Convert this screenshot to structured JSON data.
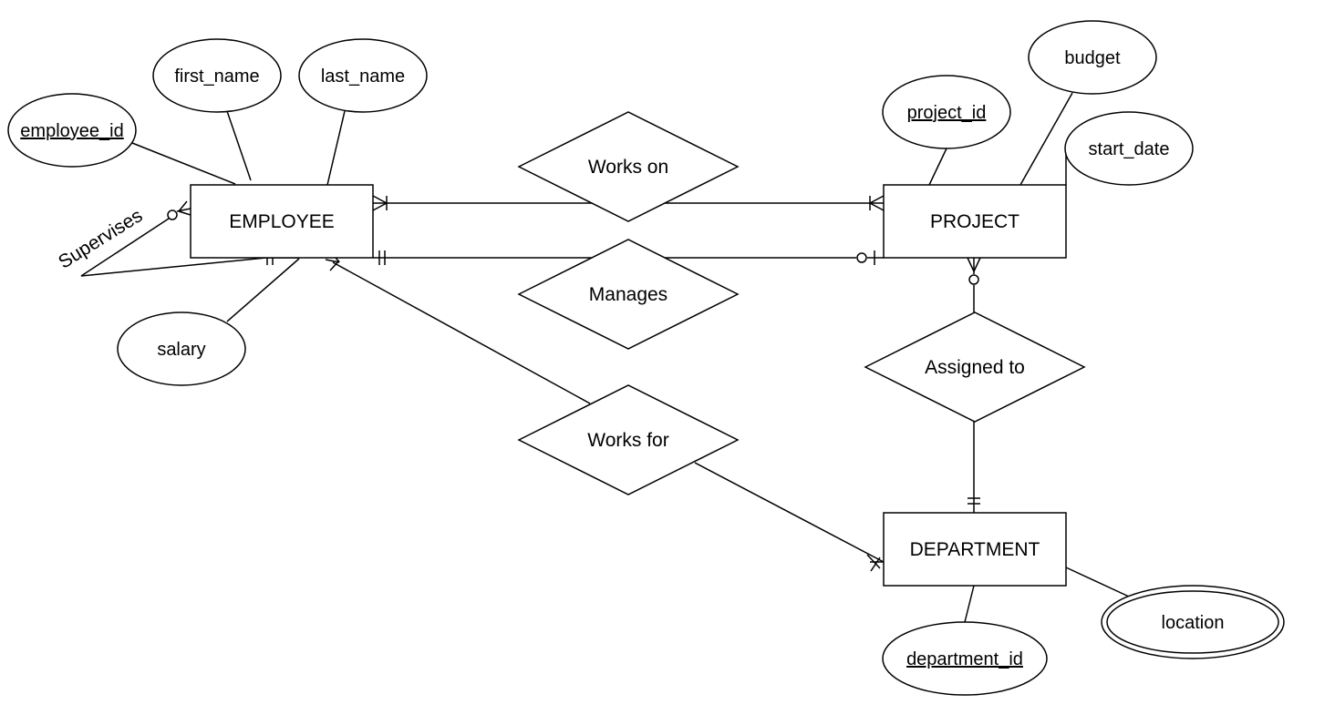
{
  "diagram": {
    "type": "entity-relationship",
    "entities": {
      "employee": {
        "name": "EMPLOYEE"
      },
      "project": {
        "name": "PROJECT"
      },
      "department": {
        "name": "DEPARTMENT"
      }
    },
    "attributes": {
      "employee_id": {
        "name": "employee_id",
        "key": true,
        "entity": "EMPLOYEE"
      },
      "first_name": {
        "name": "first_name",
        "key": false,
        "entity": "EMPLOYEE"
      },
      "last_name": {
        "name": "last_name",
        "key": false,
        "entity": "EMPLOYEE"
      },
      "salary": {
        "name": "salary",
        "key": false,
        "entity": "EMPLOYEE"
      },
      "project_id": {
        "name": "project_id",
        "key": true,
        "entity": "PROJECT"
      },
      "budget": {
        "name": "budget",
        "key": false,
        "entity": "PROJECT"
      },
      "start_date": {
        "name": "start_date",
        "key": false,
        "entity": "PROJECT"
      },
      "department_id": {
        "name": "department_id",
        "key": true,
        "entity": "DEPARTMENT"
      },
      "location": {
        "name": "location",
        "key": false,
        "multivalued": true,
        "entity": "DEPARTMENT"
      }
    },
    "relationships": {
      "works_on": {
        "name": "Works on",
        "from": "EMPLOYEE",
        "to": "PROJECT",
        "from_cardinality": "one-or-many",
        "to_cardinality": "one-or-many"
      },
      "manages": {
        "name": "Manages",
        "from": "EMPLOYEE",
        "to": "PROJECT",
        "from_cardinality": "exactly-one",
        "to_cardinality": "zero-or-one"
      },
      "works_for": {
        "name": "Works for",
        "from": "EMPLOYEE",
        "to": "DEPARTMENT",
        "from_cardinality": "many",
        "to_cardinality": "one-or-many"
      },
      "assigned_to": {
        "name": "Assigned to",
        "from": "PROJECT",
        "to": "DEPARTMENT",
        "from_cardinality": "zero-or-many",
        "to_cardinality": "exactly-one"
      },
      "supervises": {
        "name": "Supervises",
        "from": "EMPLOYEE",
        "to": "EMPLOYEE",
        "from_cardinality": "zero-or-many",
        "to_cardinality": "exactly-one"
      }
    }
  }
}
